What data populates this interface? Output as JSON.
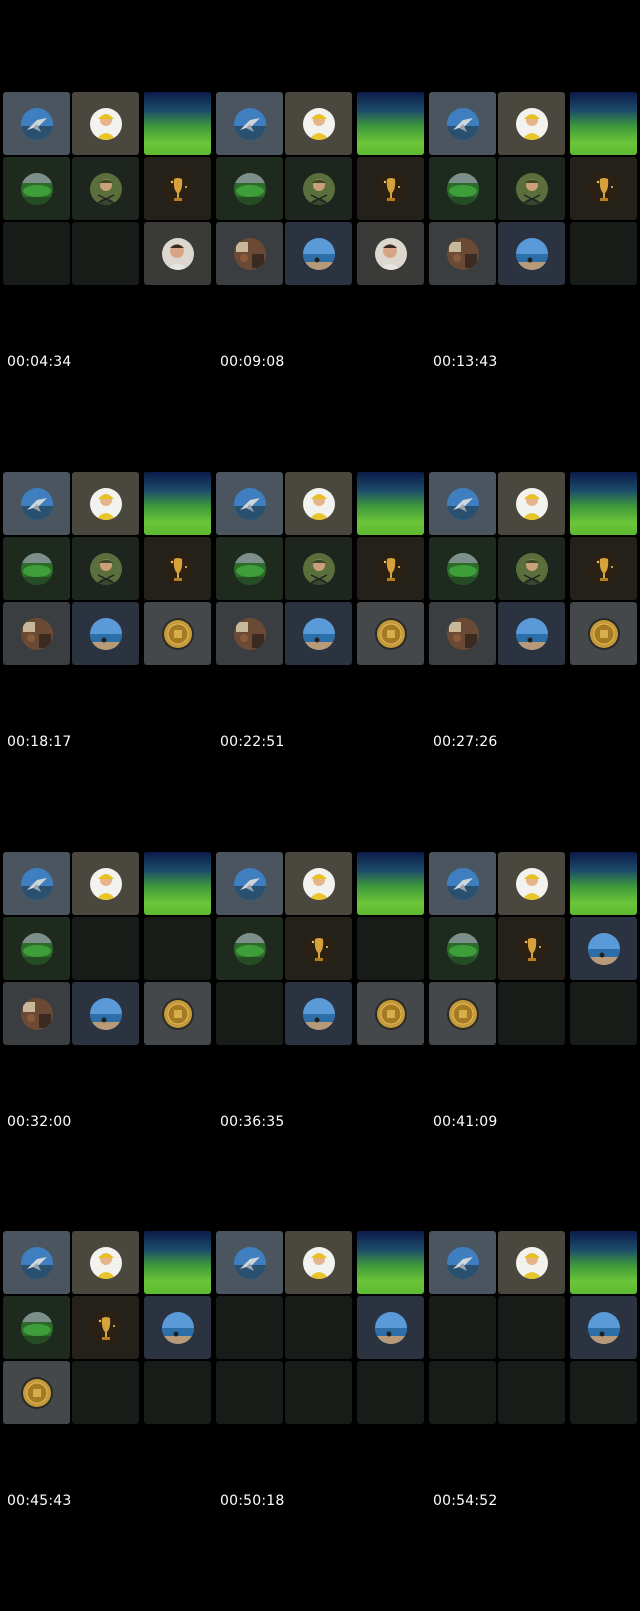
{
  "timestamps": [
    "00:04:34",
    "00:09:08",
    "00:13:43",
    "00:18:17",
    "00:22:51",
    "00:27:26",
    "00:32:00",
    "00:36:35",
    "00:41:09",
    "00:45:43",
    "00:50:18",
    "00:54:52"
  ],
  "avatars": {
    "jet": {
      "label": "jet-avatar",
      "bg": "#4a5560"
    },
    "yellow_person": {
      "label": "yellow-person-avatar",
      "bg": "#4a473f"
    },
    "pitch": {
      "label": "pitch-banner",
      "bg": "#3e8f35"
    },
    "stadium": {
      "label": "stadium-avatar",
      "bg": "#1f2a1f"
    },
    "soldier": {
      "label": "soldier-avatar",
      "bg": "#1e251e"
    },
    "trophy": {
      "label": "trophy-avatar",
      "bg": "#24201a"
    },
    "man": {
      "label": "man-avatar",
      "bg": "#3a3a38"
    },
    "room": {
      "label": "room-avatar",
      "bg": "#3b3e41"
    },
    "ocean": {
      "label": "ocean-avatar",
      "bg": "#2b3340"
    },
    "coin": {
      "label": "coin-avatar",
      "bg": "#45484a"
    },
    "empty": {
      "label": "empty-tile",
      "bg": "#181c19"
    }
  },
  "frames": [
    [
      "jet",
      "yellow_person",
      "pitch",
      "stadium",
      "soldier",
      "trophy",
      "empty",
      "empty",
      "man"
    ],
    [
      "jet",
      "yellow_person",
      "pitch",
      "stadium",
      "soldier",
      "trophy",
      "room",
      "ocean",
      "man"
    ],
    [
      "jet",
      "yellow_person",
      "pitch",
      "stadium",
      "soldier",
      "trophy",
      "room",
      "ocean",
      "empty"
    ],
    [
      "jet",
      "yellow_person",
      "pitch",
      "stadium",
      "soldier",
      "trophy",
      "room",
      "ocean",
      "coin"
    ],
    [
      "jet",
      "yellow_person",
      "pitch",
      "stadium",
      "soldier",
      "trophy",
      "room",
      "ocean",
      "coin"
    ],
    [
      "jet",
      "yellow_person",
      "pitch",
      "stadium",
      "soldier",
      "trophy",
      "room",
      "ocean",
      "coin"
    ],
    [
      "jet",
      "yellow_person",
      "pitch",
      "stadium",
      "empty",
      "empty",
      "room",
      "ocean",
      "coin"
    ],
    [
      "jet",
      "yellow_person",
      "pitch",
      "stadium",
      "trophy",
      "empty",
      "empty",
      "ocean",
      "coin"
    ],
    [
      "jet",
      "yellow_person",
      "pitch",
      "stadium",
      "trophy",
      "ocean",
      "coin",
      "empty",
      "empty"
    ],
    [
      "jet",
      "yellow_person",
      "pitch",
      "stadium",
      "trophy",
      "ocean",
      "coin",
      "empty",
      "empty"
    ],
    [
      "jet",
      "yellow_person",
      "pitch",
      "empty",
      "empty",
      "ocean",
      "empty",
      "empty",
      "empty"
    ],
    [
      "jet",
      "yellow_person",
      "pitch",
      "empty",
      "empty",
      "ocean",
      "empty",
      "empty",
      "empty"
    ]
  ]
}
